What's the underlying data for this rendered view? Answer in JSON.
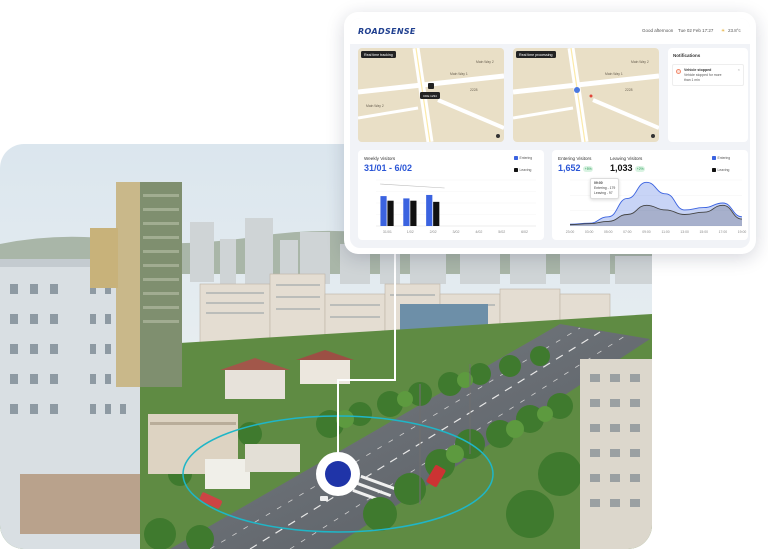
{
  "dashboard": {
    "logo": "ROADSENSE",
    "greeting": "Good afternoon",
    "date": "Tue 02 Feb 17:27",
    "weather": "23.8°c",
    "map_panels": [
      {
        "tag": "Real time tracking",
        "labels": [
          "Main Way 2",
          "Main Way 1",
          "Main Way 2",
          "2228"
        ],
        "marker_label": "CDE 1234",
        "marker_sub": "09:30 - 12:28"
      },
      {
        "tag": "Real time processing",
        "labels": [
          "Main Way 2",
          "Main Way 1",
          "2228"
        ]
      }
    ],
    "notifications": {
      "title": "Notifications",
      "items": [
        {
          "heading": "Vehicle stopped",
          "body": "Vehicle stopped for more than 1 min",
          "close": "×"
        }
      ]
    },
    "weekly_visitors": {
      "title": "Weekly Visitors",
      "range": "31/01 - 6/02",
      "legend": [
        {
          "label": "Entering",
          "color": "#3b63e0"
        },
        {
          "label": "Leaving",
          "color": "#111111"
        }
      ]
    },
    "entering_leaving": {
      "entering_title": "Entering Visitors",
      "entering_value": "1,652",
      "entering_badge": "+5%",
      "leaving_title": "Leaving Visitors",
      "leaving_value": "1,033",
      "leaving_badge": "+2%",
      "legend": [
        {
          "label": "Entering",
          "color": "#3b63e0"
        },
        {
          "label": "Leaving",
          "color": "#111111"
        }
      ],
      "tooltip": {
        "time": "09:00",
        "entering": "Entering - 179",
        "leaving": "Leaving - 97"
      }
    }
  },
  "chart_data": [
    {
      "type": "bar",
      "title": "Weekly Visitors",
      "categories": [
        "31/01",
        "1/02",
        "2/02",
        "3/02",
        "4/02",
        "5/02",
        "6/02"
      ],
      "series": [
        {
          "name": "Entering",
          "values": [
            26,
            24,
            27,
            0,
            0,
            0,
            0
          ]
        },
        {
          "name": "Leaving",
          "values": [
            22,
            22,
            21,
            0,
            0,
            0,
            0
          ]
        }
      ],
      "ylim": [
        0,
        40
      ],
      "legend": "top-right"
    },
    {
      "type": "area",
      "title": "Entering Visitors / Leaving Visitors",
      "x": [
        "23:00",
        "03:00",
        "05:00",
        "07:00",
        "09:00",
        "11:00",
        "13:00",
        "15:00",
        "17:00",
        "19:00"
      ],
      "series": [
        {
          "name": "Entering",
          "values": [
            4,
            6,
            20,
            60,
            95,
            70,
            35,
            40,
            50,
            20
          ]
        },
        {
          "name": "Leaving",
          "values": [
            3,
            5,
            10,
            25,
            45,
            35,
            25,
            30,
            45,
            15
          ]
        }
      ],
      "ylim": [
        0,
        100
      ],
      "legend": "top-right"
    }
  ],
  "colors": {
    "accent": "#2b56d6",
    "ring": "#1fb6c7",
    "marker": "#1f34a8"
  }
}
